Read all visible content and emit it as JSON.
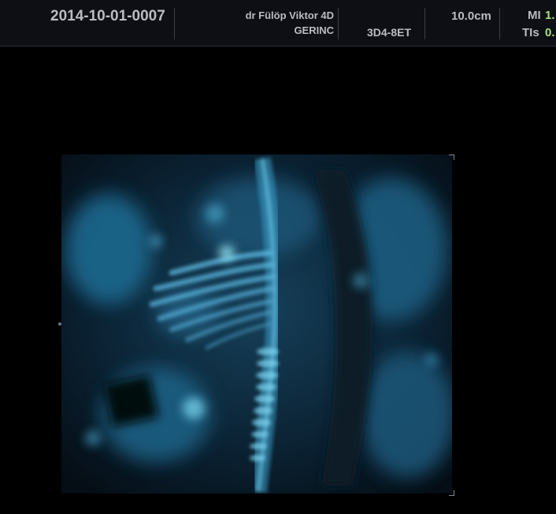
{
  "header": {
    "exam_id": "2014-10-01-0007",
    "site_name": "dr Fülöp Viktor 4D",
    "preset": "GERINC",
    "probe": "3D4-8ET",
    "depth": "10.0cm",
    "mi_label": "MI",
    "mi_value": "1.",
    "tis_label": "TIs",
    "tis_value": "0."
  },
  "colors": {
    "header_bg": "#0d0f14",
    "text": "#b9bcc2",
    "index_value": "#a8e07a",
    "volume_tint": "#3fb4e0"
  },
  "image": {
    "type": "3D volume rendering",
    "icon": "ultrasound-volume-render"
  }
}
